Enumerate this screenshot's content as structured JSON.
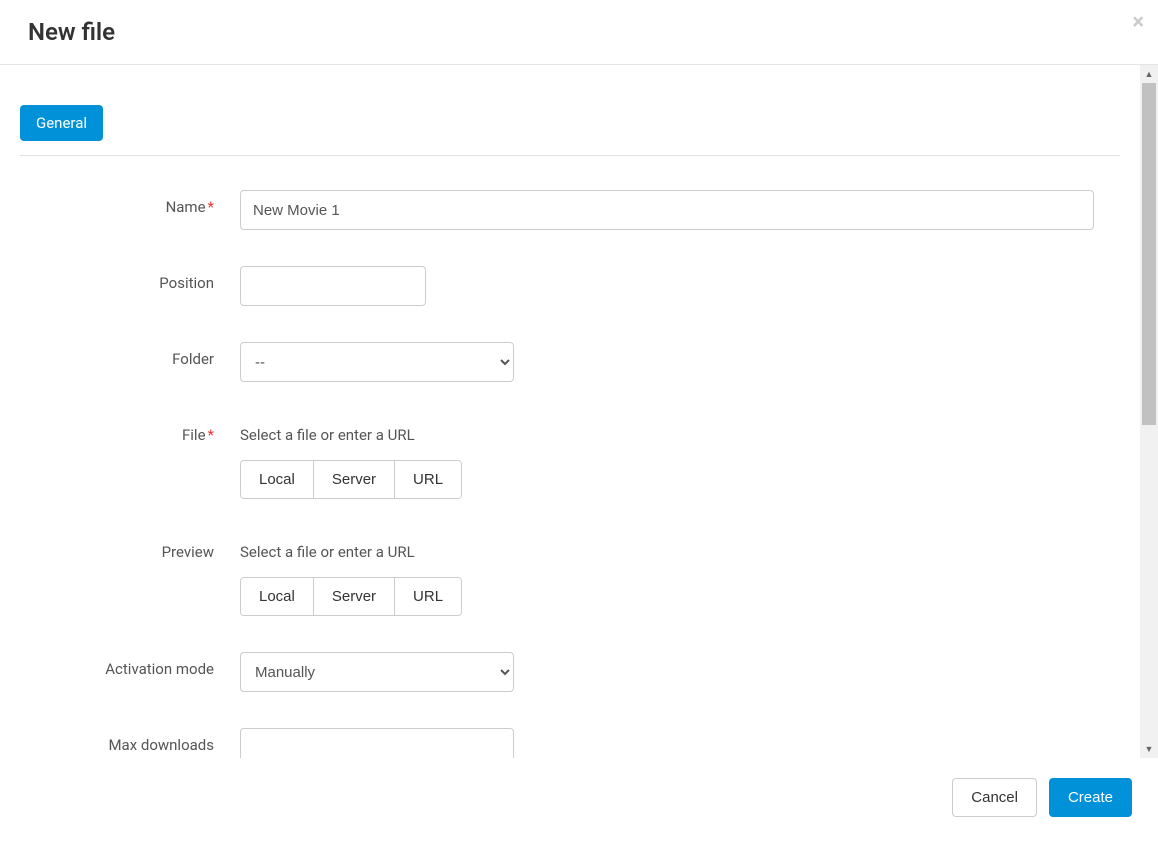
{
  "modal": {
    "title": "New file"
  },
  "tabs": {
    "general": "General"
  },
  "labels": {
    "name": "Name",
    "position": "Position",
    "folder": "Folder",
    "file": "File",
    "preview": "Preview",
    "activation_mode": "Activation mode",
    "max_downloads": "Max downloads"
  },
  "fields": {
    "name_value": "New Movie 1",
    "position_value": "",
    "folder_selected": "--",
    "activation_mode_selected": "Manually",
    "max_downloads_value": ""
  },
  "helper": {
    "file_hint": "Select a file or enter a URL",
    "preview_hint": "Select a file or enter a URL"
  },
  "source_buttons": {
    "local": "Local",
    "server": "Server",
    "url": "URL"
  },
  "footer": {
    "cancel": "Cancel",
    "create": "Create"
  }
}
